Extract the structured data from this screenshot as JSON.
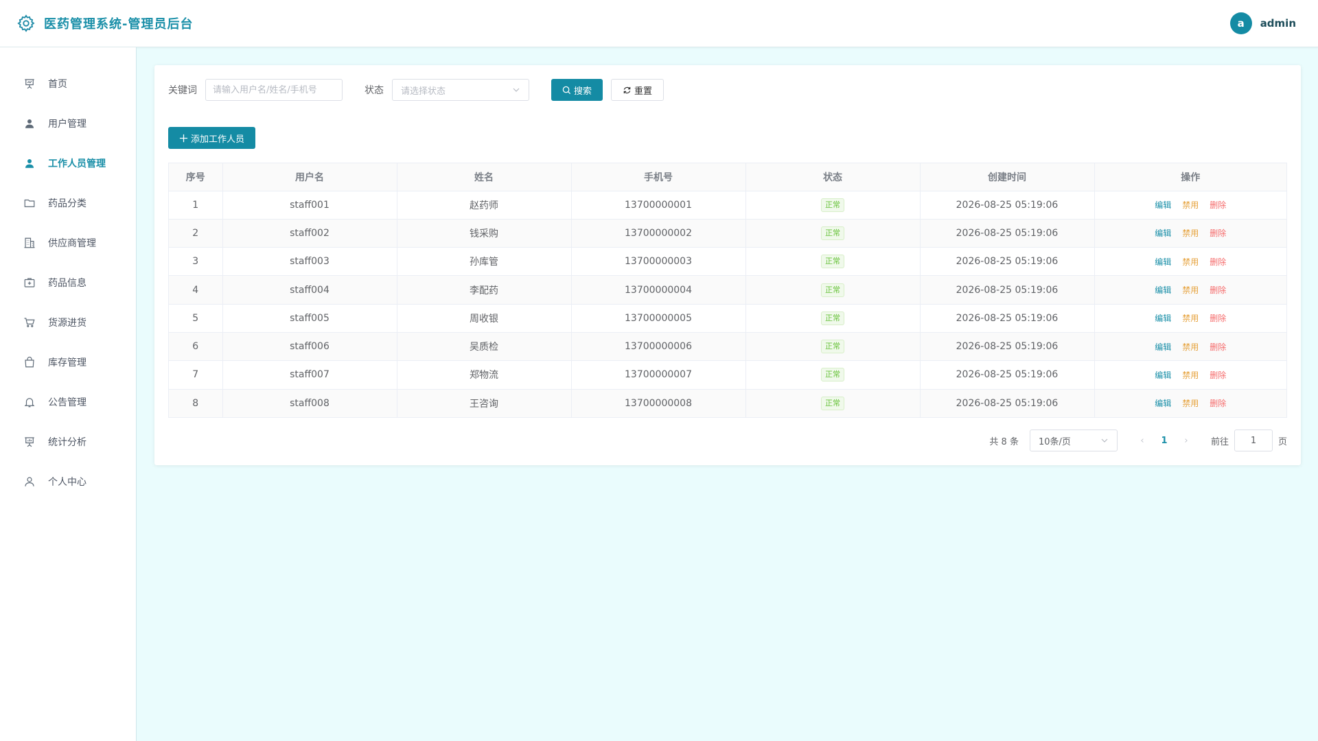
{
  "header": {
    "title": "医药管理系统-管理员后台",
    "avatar_letter": "a",
    "username": "admin"
  },
  "sidebar": {
    "items": [
      {
        "label": "首页",
        "icon": "presentation-icon"
      },
      {
        "label": "用户管理",
        "icon": "user-filled-icon"
      },
      {
        "label": "工作人员管理",
        "icon": "user-filled-icon",
        "active": true
      },
      {
        "label": "药品分类",
        "icon": "folder-icon"
      },
      {
        "label": "供应商管理",
        "icon": "building-icon"
      },
      {
        "label": "药品信息",
        "icon": "first-aid-kit-icon"
      },
      {
        "label": "货源进货",
        "icon": "shopping-cart-icon"
      },
      {
        "label": "库存管理",
        "icon": "shopping-bag-icon"
      },
      {
        "label": "公告管理",
        "icon": "bell-icon"
      },
      {
        "label": "统计分析",
        "icon": "data-board-icon"
      },
      {
        "label": "个人中心",
        "icon": "user-outline-icon"
      }
    ]
  },
  "filters": {
    "keyword_label": "关键词",
    "keyword_placeholder": "请输入用户名/姓名/手机号",
    "status_label": "状态",
    "status_placeholder": "请选择状态",
    "search_label": "搜索",
    "reset_label": "重置"
  },
  "actions": {
    "add_label": "添加工作人员"
  },
  "table": {
    "columns": [
      "序号",
      "用户名",
      "姓名",
      "手机号",
      "状态",
      "创建时间",
      "操作"
    ],
    "op_labels": {
      "edit": "编辑",
      "disable": "禁用",
      "delete": "删除"
    },
    "rows": [
      {
        "index": "1",
        "username": "staff001",
        "name": "赵药师",
        "phone": "13700000001",
        "status": "正常",
        "created": "2026-08-25 05:19:06"
      },
      {
        "index": "2",
        "username": "staff002",
        "name": "钱采购",
        "phone": "13700000002",
        "status": "正常",
        "created": "2026-08-25 05:19:06"
      },
      {
        "index": "3",
        "username": "staff003",
        "name": "孙库管",
        "phone": "13700000003",
        "status": "正常",
        "created": "2026-08-25 05:19:06"
      },
      {
        "index": "4",
        "username": "staff004",
        "name": "李配药",
        "phone": "13700000004",
        "status": "正常",
        "created": "2026-08-25 05:19:06"
      },
      {
        "index": "5",
        "username": "staff005",
        "name": "周收银",
        "phone": "13700000005",
        "status": "正常",
        "created": "2026-08-25 05:19:06"
      },
      {
        "index": "6",
        "username": "staff006",
        "name": "吴质检",
        "phone": "13700000006",
        "status": "正常",
        "created": "2026-08-25 05:19:06"
      },
      {
        "index": "7",
        "username": "staff007",
        "name": "郑物流",
        "phone": "13700000007",
        "status": "正常",
        "created": "2026-08-25 05:19:06"
      },
      {
        "index": "8",
        "username": "staff008",
        "name": "王咨询",
        "phone": "13700000008",
        "status": "正常",
        "created": "2026-08-25 05:19:06"
      }
    ]
  },
  "pagination": {
    "total_text": "共 8 条",
    "page_size": "10条/页",
    "current_page": "1",
    "goto_label": "前往",
    "goto_value": "1",
    "page_unit": "页"
  },
  "colors": {
    "primary": "#148ba4",
    "success": "#67c23a",
    "warning": "#e6a23c",
    "danger": "#f56c6c",
    "background": "#eafcfd"
  }
}
